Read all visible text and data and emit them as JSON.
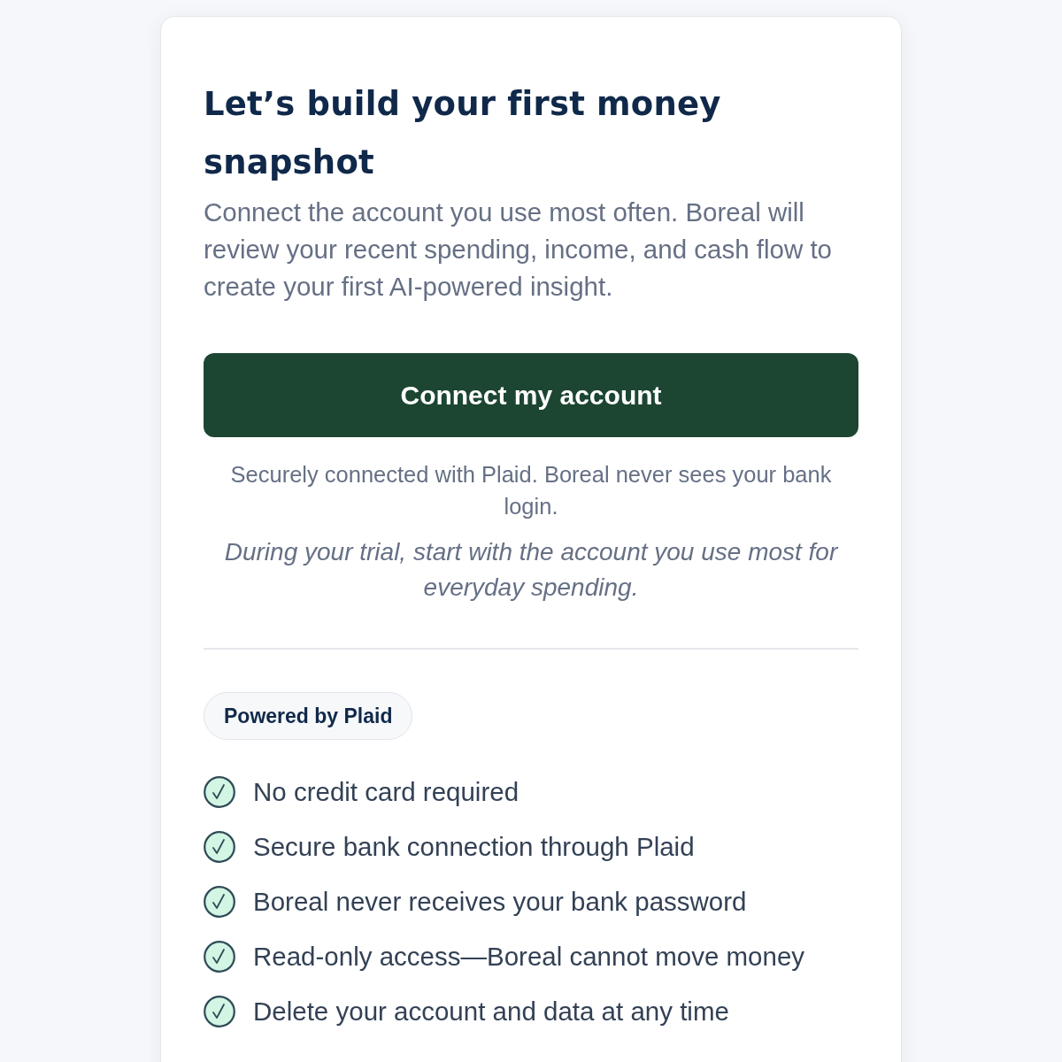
{
  "heading": "Let’s build your first money snapshot",
  "intro": "Connect the account you use most often. Boreal will review your recent spending, income, and cash flow to create your first AI-powered insight.",
  "connect_button": {
    "label": "Connect my account"
  },
  "security_note": "Securely connected with Plaid. Boreal never sees your bank login.",
  "trial_note": "During your trial, start with the account you use most for everyday spending.",
  "badge": "Powered by Plaid",
  "benefits": [
    {
      "text": "No credit card required"
    },
    {
      "text": "Secure bank connection through Plaid"
    },
    {
      "text": "Boreal never receives your bank password"
    },
    {
      "text": "Read-only access—Boreal cannot move money"
    },
    {
      "text": "Delete your account and data at any time"
    }
  ]
}
